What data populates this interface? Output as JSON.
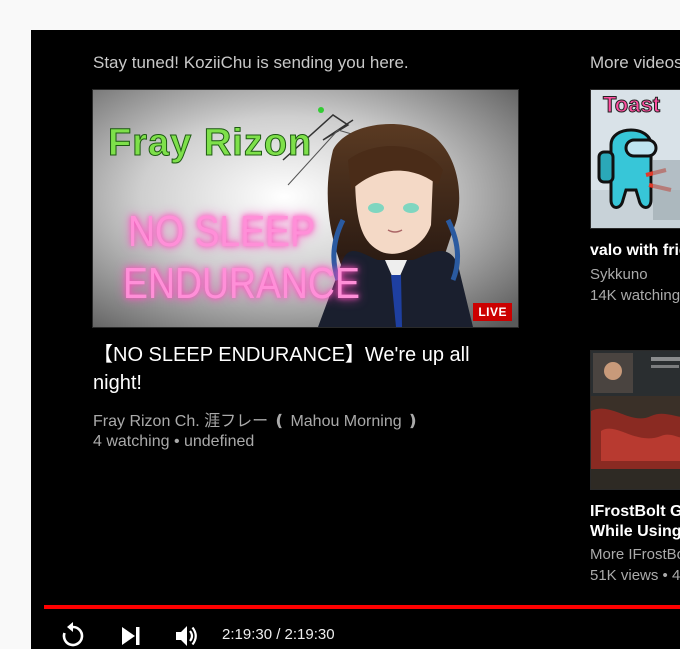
{
  "endscreen": {
    "sending_text": "Stay tuned! KoziiChu is sending you here.",
    "more_videos_label": "More videos",
    "featured": {
      "thumb_text_top": "Fray Rizon",
      "thumb_text_main_1": "NO SLEEP",
      "thumb_text_main_2": "ENDURANCE",
      "live_badge": "LIVE",
      "title": "【NO SLEEP ENDURANCE】We're up all night!",
      "channel": "Fray Rizon Ch. 涯フレー ❪ Mahou Morning ❫",
      "stats": "4 watching • undefined"
    },
    "suggestions": [
      {
        "thumb_text": "Toast",
        "title": "valo with friends",
        "channel": "Sykkuno",
        "stats": "14K watching"
      },
      {
        "title_line1": "IFrostBolt Gets",
        "title_line2": "While Using",
        "channel": "More IFrostBolt",
        "stats": "51K views • 4"
      }
    ]
  },
  "controls": {
    "time": "2:19:30 / 2:19:30",
    "progress": 1.0
  },
  "colors": {
    "progress": "#ff0000",
    "live_badge": "#cc0000",
    "background": "#000000"
  },
  "icons": [
    "replay-icon",
    "next-icon",
    "volume-icon"
  ]
}
